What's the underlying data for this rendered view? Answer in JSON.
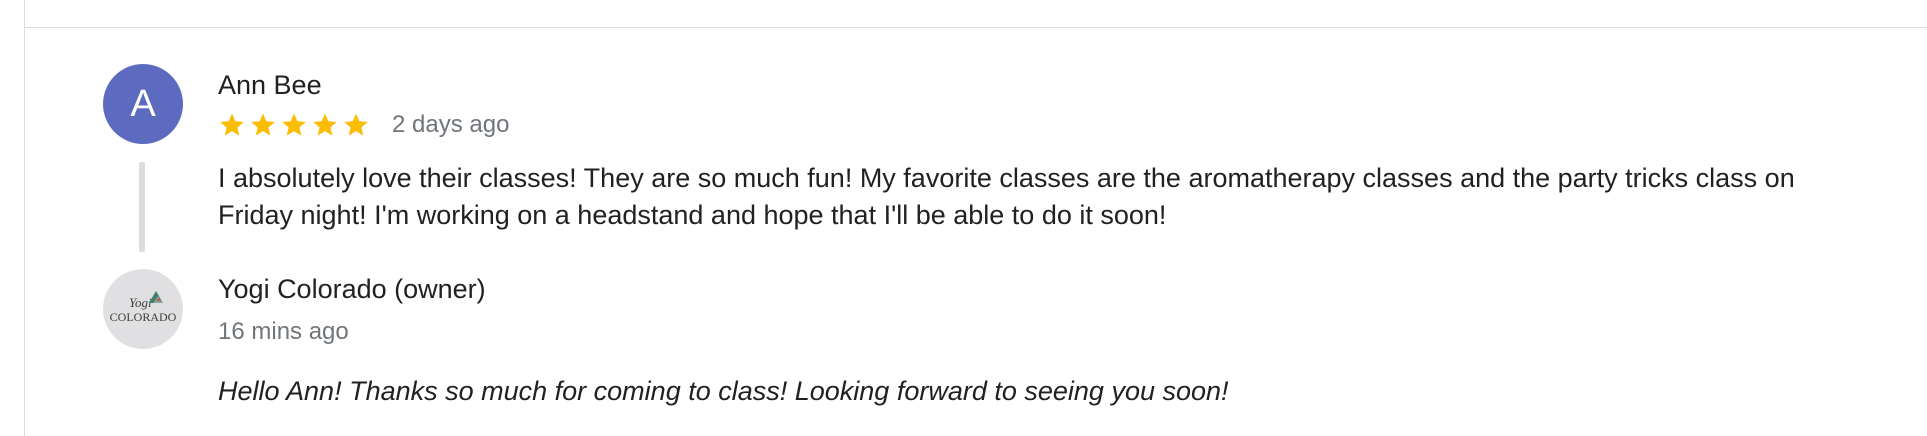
{
  "review": {
    "avatar_initial": "A",
    "avatar_color": "#5c6bc0",
    "author": "Ann Bee",
    "rating": 5,
    "rating_max": 5,
    "star_color": "#fbbc04",
    "time": "2 days ago",
    "text": "I absolutely love their classes! They are so much fun! My favorite classes are the aromatherapy classes and the party tricks class on Friday night! I'm working on a headstand and hope that I'll be able to do it soon!"
  },
  "reply": {
    "logo_text_top": "Yogi",
    "logo_text_bottom": "COLORADO",
    "author": "Yogi Colorado (owner)",
    "time": "16 mins ago",
    "text": "Hello Ann! Thanks so much for coming to class! Looking forward to seeing you soon!"
  }
}
